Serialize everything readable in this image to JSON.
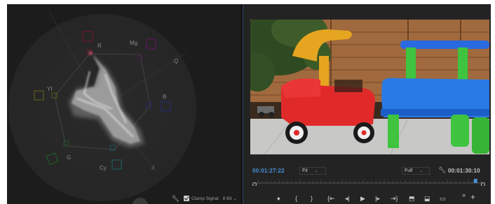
{
  "scope": {
    "targets": {
      "r": "R",
      "mg": "Mg",
      "b": "B",
      "cy": "Cy",
      "g": "G",
      "yl": "YI",
      "q": "Q",
      "i": "-I"
    },
    "footer": {
      "clamp_label": "Clamp Signal",
      "clamp_checked": true,
      "bit_depth": "8 Bit",
      "chevron": "⌄"
    }
  },
  "monitor": {
    "current_timecode": "00:01:27:22",
    "zoom": "Fit",
    "resolution": "Full",
    "duration_timecode": "00:01:30:10",
    "playhead_fraction": 0.97
  },
  "colors": {
    "timecode_accent": "#4a8fd6",
    "panel_bg": "#232323",
    "scope_bg": "#1c1c1c"
  },
  "transport": {
    "buttons": [
      {
        "icon": "marker-icon",
        "glyph": "♦"
      },
      {
        "icon": "mark-in-icon",
        "glyph": "{"
      },
      {
        "icon": "mark-out-icon",
        "glyph": "}"
      },
      {
        "icon": "go-to-in-icon",
        "glyph": "{⇤"
      },
      {
        "icon": "step-back-icon",
        "glyph": "◂|"
      },
      {
        "icon": "play-icon",
        "glyph": "▶"
      },
      {
        "icon": "step-forward-icon",
        "glyph": "|▸"
      },
      {
        "icon": "go-to-out-icon",
        "glyph": "⇥}"
      },
      {
        "icon": "lift-icon",
        "glyph": "⬒"
      },
      {
        "icon": "extract-icon",
        "glyph": "⬓"
      },
      {
        "icon": "export-frame-icon",
        "glyph": "▭"
      },
      {
        "icon": "more-icon",
        "glyph": "»"
      },
      {
        "icon": "add-button-icon",
        "glyph": "+"
      }
    ]
  }
}
